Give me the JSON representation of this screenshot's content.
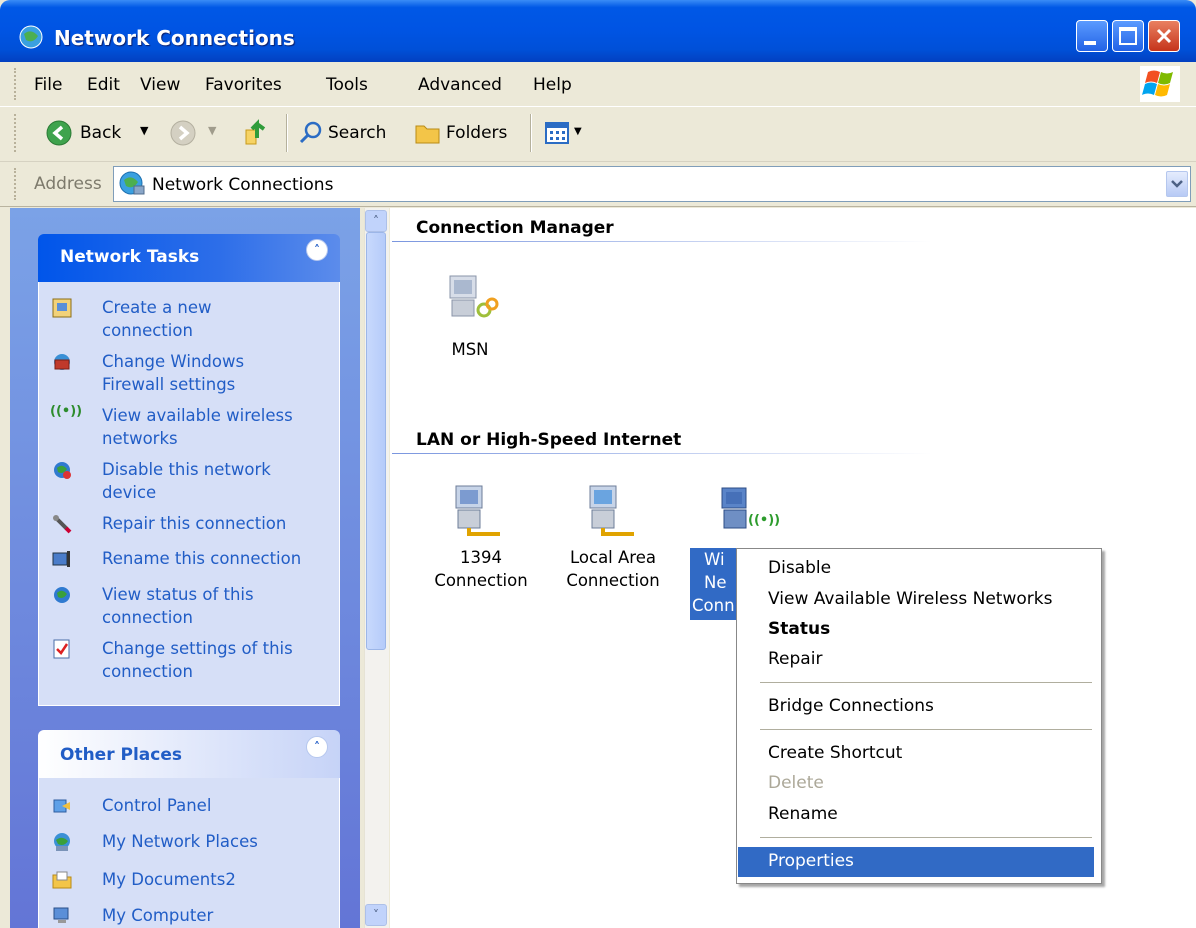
{
  "window": {
    "title": "Network Connections"
  },
  "menubar": {
    "items": [
      "File",
      "Edit",
      "View",
      "Favorites",
      "Tools",
      "Advanced",
      "Help"
    ]
  },
  "toolbar": {
    "back_label": "Back",
    "search_label": "Search",
    "folders_label": "Folders"
  },
  "address": {
    "label": "Address",
    "value": "Network Connections"
  },
  "task_pane": {
    "network_tasks": {
      "title": "Network Tasks",
      "items": [
        {
          "line1": "Create a new",
          "line2": "connection",
          "icon": "new-connection-icon"
        },
        {
          "line1": "Change Windows",
          "line2": "Firewall settings",
          "icon": "firewall-icon"
        },
        {
          "line1": "View available wireless",
          "line2": "networks",
          "icon": "wireless-icon"
        },
        {
          "line1": "Disable this network",
          "line2": "device",
          "icon": "disable-network-icon"
        },
        {
          "line1": "Repair this connection",
          "line2": "",
          "icon": "repair-icon"
        },
        {
          "line1": "Rename this connection",
          "line2": "",
          "icon": "rename-icon"
        },
        {
          "line1": "View status of this",
          "line2": "connection",
          "icon": "status-icon"
        },
        {
          "line1": "Change settings of this",
          "line2": "connection",
          "icon": "settings-icon"
        }
      ]
    },
    "other_places": {
      "title": "Other Places",
      "items": [
        "Control Panel",
        "My Network Places",
        "My Documents2",
        "My Computer"
      ]
    }
  },
  "groups": {
    "connection_manager": {
      "title": "Connection Manager",
      "items": [
        {
          "label": "MSN"
        }
      ]
    },
    "lan": {
      "title": "LAN or High-Speed Internet",
      "items": [
        {
          "line1": "1394",
          "line2": "Connection"
        },
        {
          "line1": "Local Area",
          "line2": "Connection"
        },
        {
          "line1": "Wi",
          "line2": "Ne",
          "line3": "Conn"
        }
      ]
    }
  },
  "context_menu": {
    "items": [
      "Disable",
      "View Available Wireless Networks",
      "Status",
      "Repair",
      "Bridge Connections",
      "Create Shortcut",
      "Delete",
      "Rename",
      "Properties"
    ]
  },
  "colors": {
    "title_bar": "#0054E3",
    "selection": "#316AC5",
    "task_link": "#215DC6"
  }
}
